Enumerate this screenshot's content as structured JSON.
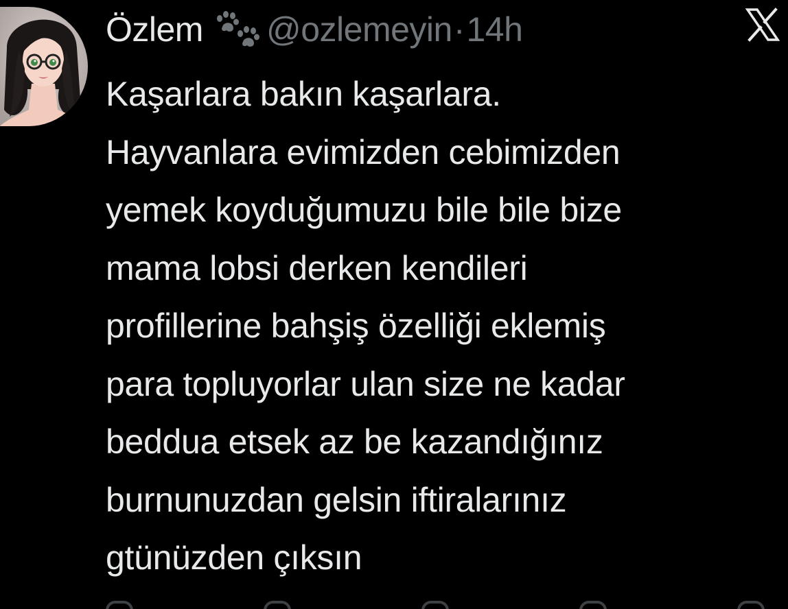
{
  "user": {
    "display_name": "Özlem",
    "badge_icon": "paw-print-icon",
    "handle": "@ozlemeyin",
    "separator": "·",
    "time": "14h"
  },
  "platform_icon": "x-logo-icon",
  "tweet_lines": [
    "Kaşarlara bakın kaşarlara.",
    "Hayvanlara evimizden cebimizden",
    "yemek koyduğumuzu bile bile bize",
    "mama lobsi derken kendileri",
    "profillerine bahşiş özelliği eklemiş",
    "para topluyorlar ulan size ne kadar",
    "beddua etsek az be kazandığınız",
    "burnunuzdan gelsin iftiralarınız",
    "gtünüzden çıksın"
  ],
  "colors": {
    "background": "#000000",
    "text": "#e7e9ea",
    "secondary": "#71767b"
  }
}
